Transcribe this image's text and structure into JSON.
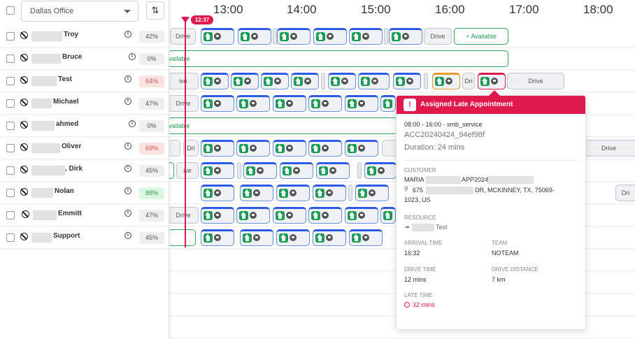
{
  "header": {
    "office_select": "Dallas Office",
    "hours": [
      "13:00",
      "14:00",
      "15:00",
      "16:00",
      "17:00",
      "18:00"
    ],
    "now_time": "12:37"
  },
  "resources": [
    {
      "name": "Troy",
      "pct": "42%",
      "pct_state": "neutral"
    },
    {
      "name": "Bruce",
      "pct": "0%",
      "pct_state": "neutral"
    },
    {
      "name": "Test",
      "pct": "64%",
      "pct_state": "bad"
    },
    {
      "name": "Michael",
      "pct": "47%",
      "pct_state": "neutral"
    },
    {
      "name": "ahmed",
      "pct": "0%",
      "pct_state": "neutral"
    },
    {
      "name": "Oliver",
      "pct": "69%",
      "pct_state": "bad"
    },
    {
      "name": ", Dirk",
      "pct": "45%",
      "pct_state": "neutral"
    },
    {
      "name": "Nolan",
      "pct": "88%",
      "pct_state": "good"
    },
    {
      "name": "Emmitt",
      "pct": "47%",
      "pct_state": "neutral"
    },
    {
      "name": "Support",
      "pct": "45%",
      "pct_state": "neutral"
    }
  ],
  "timeline": {
    "drive_label": "Drive",
    "drive_short": "Dri",
    "drive_cut": "ive",
    "available_label": "+ Available",
    "available_cut": "vailable"
  },
  "popup": {
    "title": "Assigned Late Appointment",
    "window": "08:00 - 16:00 · smb_service",
    "appointment_id": "ACC20240424_94ef98f",
    "duration": "Duration:  24 mins",
    "customer_label": "CUSTOMER",
    "customer_name_a": "MARIA",
    "customer_name_b": "APP2024",
    "address_a": "675",
    "address_b": "DR, MCKINNEY, TX, 75069-",
    "address_c": "1023, US",
    "resource_label": "RESOURCE",
    "resource_name": "Test",
    "arrival_label": "ARRIVAL TIME",
    "arrival_value": "16:32",
    "team_label": "TEAM",
    "team_value": "NOTEAM",
    "drive_time_label": "DRIVE TIME",
    "drive_time_value": "12 mins",
    "drive_distance_label": "DRIVE DISTANCE",
    "drive_distance_value": "7 km",
    "late_time_label": "LATE TIME",
    "late_time_value": "32 mins"
  },
  "colors": {
    "accent": "#e0194d",
    "home": "#1a9c55",
    "appt_top": "#2d5be3",
    "available": "#2fa85a"
  }
}
